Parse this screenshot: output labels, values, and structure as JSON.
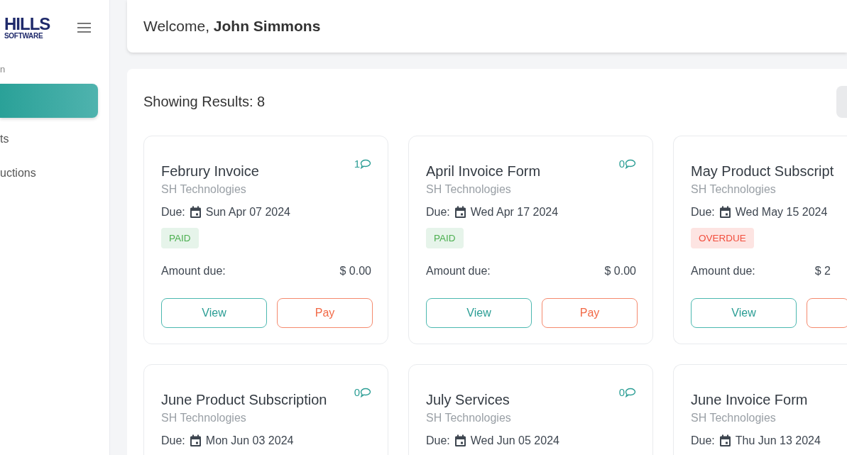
{
  "sidebar": {
    "logo": {
      "line_1": "HILLS",
      "line_2": "SOFTWARE"
    },
    "items": [
      {
        "label": "n",
        "selected": false
      },
      {
        "selected": true
      },
      {
        "label": "ts",
        "selected": false
      },
      {
        "label": "uctions",
        "selected": false
      }
    ]
  },
  "header": {
    "greeting": "Welcome, **John Simmons**"
  },
  "results": {
    "title": "Showing Results: 8",
    "cards": [
      {
        "title": "Februry Invoice",
        "comments": "1",
        "company": "SH Technologies",
        "due_label": "Due:",
        "due_date": "Sun Apr 07 2024",
        "status": {
          "kind": "paid",
          "label": "PAID"
        },
        "amount_label": "Amount due:",
        "amount": "$ 0.00",
        "view": "View",
        "pay": "Pay"
      },
      {
        "title": "April Invoice Form",
        "comments": "0",
        "company": "SH Technologies",
        "due_label": "Due:",
        "due_date": "Wed Apr 17 2024",
        "status": {
          "kind": "paid",
          "label": "PAID"
        },
        "amount_label": "Amount due:",
        "amount": "$ 0.00",
        "view": "View",
        "pay": "Pay"
      },
      {
        "title": "May Product Subscript",
        "company": "SH Technologies",
        "due_label": "Due:",
        "due_date": "Wed May 15 2024",
        "status": {
          "kind": "overdue",
          "label": "OVERDUE"
        },
        "amount_label": "Amount due:",
        "amount": "$ 2",
        "view": "View",
        "pay_cut": true
      },
      {
        "title": "June Product Subscription",
        "comments": "0",
        "company": "SH Technologies",
        "due_label": "Due:",
        "due_date": "Mon Jun 03 2024"
      },
      {
        "title": "July Services",
        "comments": "0",
        "company": "SH Technologies",
        "due_label": "Due:",
        "due_date": "Wed Jun 05 2024"
      },
      {
        "title": "June Invoice Form",
        "company": "SH Technologies",
        "due_label": "Due:",
        "due_date": "Thu Jun 13 2024"
      }
    ]
  }
}
